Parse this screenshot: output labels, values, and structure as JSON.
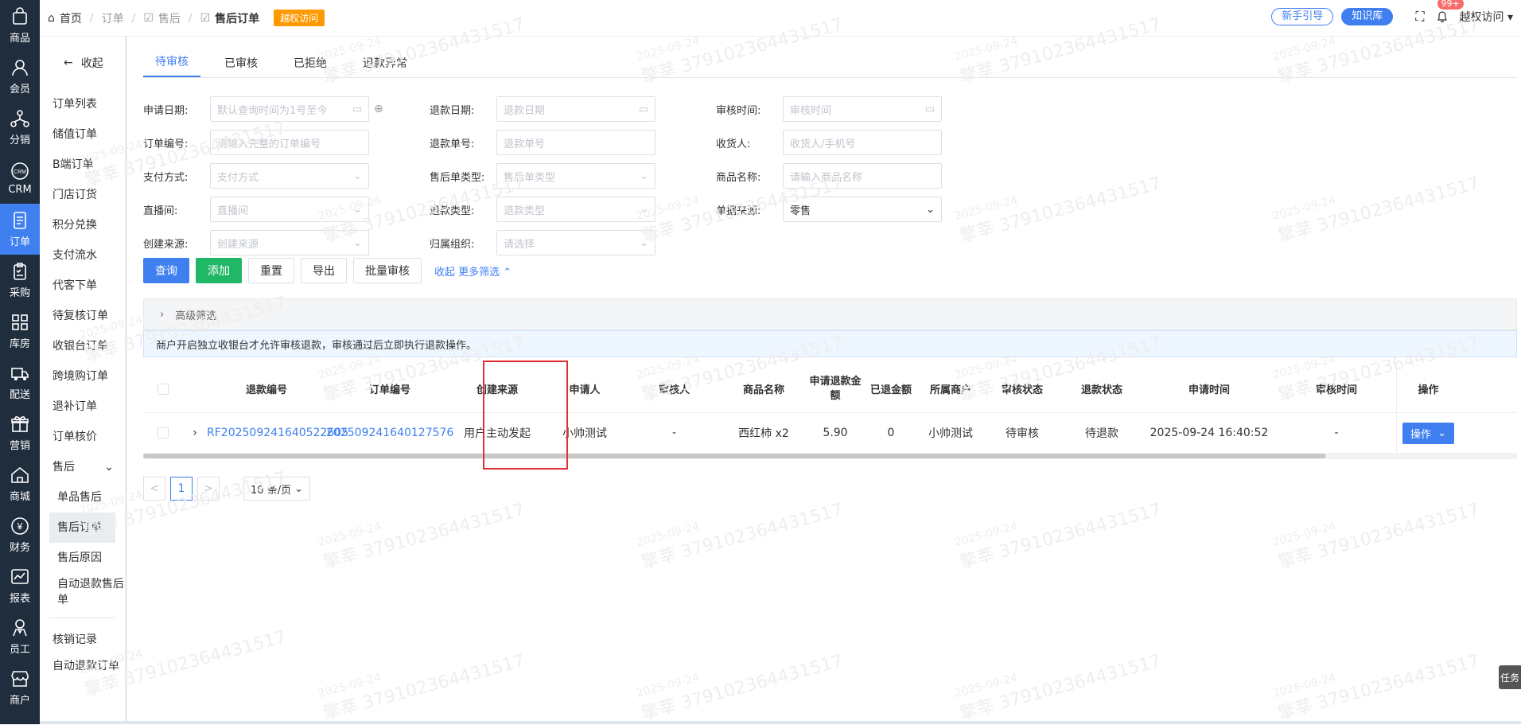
{
  "app_nav": {
    "items": [
      {
        "label": "商品",
        "icon": "bag-icon"
      },
      {
        "label": "会员",
        "icon": "user-icon"
      },
      {
        "label": "分销",
        "icon": "network-icon"
      },
      {
        "label": "CRM",
        "icon": "crm-icon"
      },
      {
        "label": "订单",
        "icon": "document-icon",
        "active": true
      },
      {
        "label": "采购",
        "icon": "clipboard-icon"
      },
      {
        "label": "库房",
        "icon": "grid-icon"
      },
      {
        "label": "配送",
        "icon": "truck-icon"
      },
      {
        "label": "营销",
        "icon": "gift-icon"
      },
      {
        "label": "商城",
        "icon": "home-icon"
      },
      {
        "label": "财务",
        "icon": "yen-icon"
      },
      {
        "label": "报表",
        "icon": "chart-icon"
      },
      {
        "label": "员工",
        "icon": "staff-icon"
      },
      {
        "label": "商户",
        "icon": "shop-icon"
      }
    ]
  },
  "submenu": {
    "collapse_label": "收起",
    "items": [
      "订单列表",
      "储值订单",
      "B端订单",
      "门店订货",
      "积分兑换",
      "支付流水",
      "代客下单",
      "待复核订单",
      "收银台订单",
      "跨境购订单",
      "退补订单",
      "订单核价"
    ],
    "group_label": "售后",
    "group_items": [
      "单品售后",
      "售后订单",
      "售后原因",
      "自动退款售后单"
    ],
    "after_items": [
      "核销记录",
      "自动退款订单"
    ]
  },
  "breadcrumb": {
    "home": "首页",
    "order": "订单",
    "aftersale": "售后",
    "current": "售后订单",
    "badge": "越权访问"
  },
  "top_right": {
    "guide": "新手引导",
    "kb": "知识库",
    "notice_count": "99+",
    "user": "越权访问"
  },
  "tabs": [
    "待审核",
    "已审核",
    "已拒绝",
    "退款异常"
  ],
  "filters": {
    "apply_date_label": "申请日期:",
    "apply_date_ph": "默认查询时间为1号至今",
    "refund_date_label": "退款日期:",
    "refund_date_ph": "退款日期",
    "audit_time_label": "审核时间:",
    "audit_time_ph": "审核时间",
    "order_no_label": "订单编号:",
    "order_no_ph": "请输入完整的订单编号",
    "refund_no_label": "退款单号:",
    "refund_no_ph": "退款单号",
    "receiver_label": "收货人:",
    "receiver_ph": "收货人/手机号",
    "pay_label": "支付方式:",
    "pay_ph": "支付方式",
    "after_type_label": "售后单类型:",
    "after_type_ph": "售后单类型",
    "goods_label": "商品名称:",
    "goods_ph": "请输入商品名称",
    "live_label": "直播间:",
    "live_ph": "直播间",
    "refund_type_label": "退款类型:",
    "refund_type_ph": "退款类型",
    "src_label": "单据来源:",
    "src_value": "零售",
    "create_label": "创建来源:",
    "create_ph": "创建来源",
    "org_label": "归属组织:",
    "org_ph": "请选择"
  },
  "buttons": {
    "query": "查询",
    "add": "添加",
    "reset": "重置",
    "export": "导出",
    "batch": "批量审核",
    "collapse": "收起",
    "more": "更多筛选"
  },
  "advanced": "高级筛选",
  "notice": "商户开启独立收银台才允许审核退款，审核通过后立即执行退款操作。",
  "table": {
    "headers": {
      "refund_no": "退款编号",
      "order_no": "订单编号",
      "source": "创建来源",
      "applicant": "申请人",
      "auditor": "审核人",
      "goods": "商品名称",
      "amount": "申请退款金额",
      "returned": "已退金额",
      "merchant": "所属商户",
      "audit_status": "审核状态",
      "refund_status": "退款状态",
      "apply_time": "申请时间",
      "audit_time": "审核时间",
      "op": "操作"
    },
    "rows": [
      {
        "refund_no": "RF202509241640522605",
        "order_no": "202509241640127576",
        "source": "用户主动发起",
        "applicant": "小帅测试",
        "auditor": "-",
        "goods": "西红柿 x2",
        "amount": "5.90",
        "returned": "0",
        "merchant": "小帅测试",
        "audit_status": "待审核",
        "refund_status": "待退款",
        "apply_time": "2025-09-24 16:40:52",
        "audit_time": "-",
        "op": "操作"
      }
    ]
  },
  "pager": {
    "prev": "<",
    "page": "1",
    "next": ">",
    "size": "10 条/页"
  },
  "task": "任务",
  "watermark": {
    "date": "2025-09-24",
    "text": "擎莘 379102364431517"
  },
  "colors": {
    "primary": "#3f7ff0",
    "success": "#20b866",
    "warning": "#ff9900",
    "nav_bg": "#1f2d3d"
  }
}
